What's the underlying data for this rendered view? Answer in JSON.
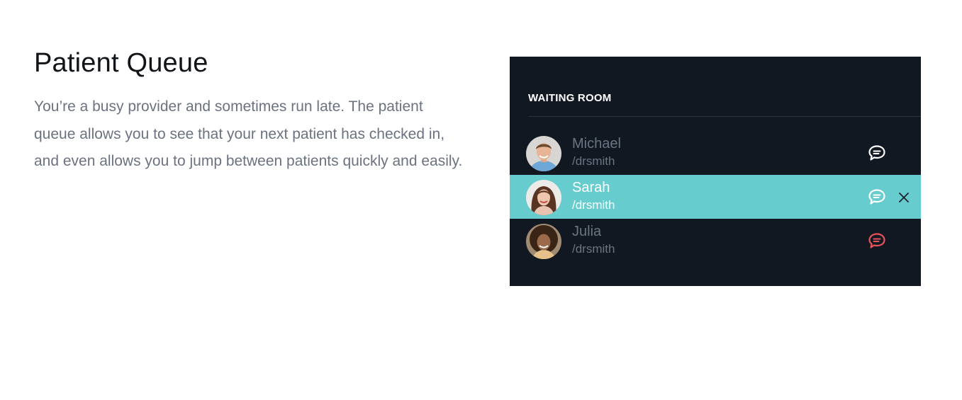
{
  "intro": {
    "title": "Patient Queue",
    "description": "You’re a busy provider and sometimes run late. The patient queue allows you to see that your next patient has checked in, and even allows you to jump between patients quickly and easily."
  },
  "waiting_room": {
    "header": "WAITING ROOM",
    "patients": [
      {
        "name": "Michael",
        "handle": "/drsmith",
        "chat_icon": "chat-bubble-icon",
        "chat_color": "#ffffff",
        "active": false
      },
      {
        "name": "Sarah",
        "handle": "/drsmith",
        "chat_icon": "chat-bubble-icon",
        "chat_color": "#ffffff",
        "active": true,
        "dismiss_icon": "close-icon"
      },
      {
        "name": "Julia",
        "handle": "/drsmith",
        "chat_icon": "chat-bubble-icon",
        "chat_color": "#e8545b",
        "active": false
      }
    ]
  },
  "colors": {
    "panel_background": "#121821",
    "active_row": "#66cccd",
    "alert": "#e8545b"
  }
}
